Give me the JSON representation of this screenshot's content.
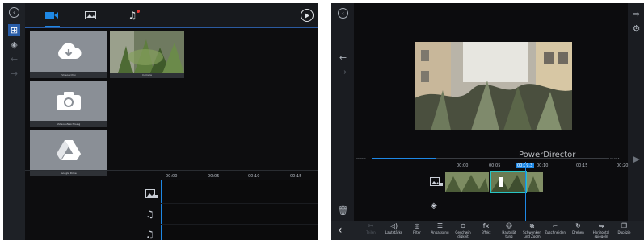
{
  "left": {
    "tabs": [
      {
        "icon": "video-icon"
      },
      {
        "icon": "image-icon"
      },
      {
        "icon": "music-icon"
      }
    ],
    "tiles": [
      {
        "label": "Videoarchiv",
        "icon": "cloud-download-icon"
      },
      {
        "label": "Camera",
        "icon": "photo-thumbnail"
      },
      {
        "label": "Videoaufzeichnung",
        "icon": "camera-icon"
      },
      {
        "label": "Google Drive",
        "icon": "google-drive-icon"
      }
    ],
    "ruler": [
      "00:00",
      "00:05",
      "00:10",
      "00:15"
    ]
  },
  "right": {
    "watermark": "PowerDirector",
    "progress": {
      "start": "00:00.0",
      "end": "00:04.5",
      "fraction": 0.27
    },
    "ruler": [
      "00:00",
      "00:05",
      "00:09.3",
      "00:10",
      "00:15",
      "00:20"
    ],
    "toolbar": [
      {
        "label": "Teilen",
        "icon": "split-icon"
      },
      {
        "label": "Lautstärke",
        "icon": "volume-icon"
      },
      {
        "label": "Filter",
        "icon": "filter-icon"
      },
      {
        "label": "Anpassung",
        "icon": "adjust-icon"
      },
      {
        "label": "Geschwin digkeit",
        "icon": "speed-icon"
      },
      {
        "label": "Effekt",
        "icon": "fx-icon"
      },
      {
        "label": "Hautglät tung",
        "icon": "skin-icon"
      },
      {
        "label": "Schwenken und Zoom",
        "icon": "pan-zoom-icon"
      },
      {
        "label": "Zuschneiden",
        "icon": "crop-icon"
      },
      {
        "label": "Drehen",
        "icon": "rotate-icon"
      },
      {
        "label": "Horizontal spiegeln",
        "icon": "flip-icon"
      },
      {
        "label": "Duplizie",
        "icon": "duplicate-icon"
      }
    ]
  },
  "colors": {
    "accent": "#1e88e5",
    "teal": "#29c4c4",
    "bg": "#0d0d0f",
    "rail": "#1e2126"
  }
}
